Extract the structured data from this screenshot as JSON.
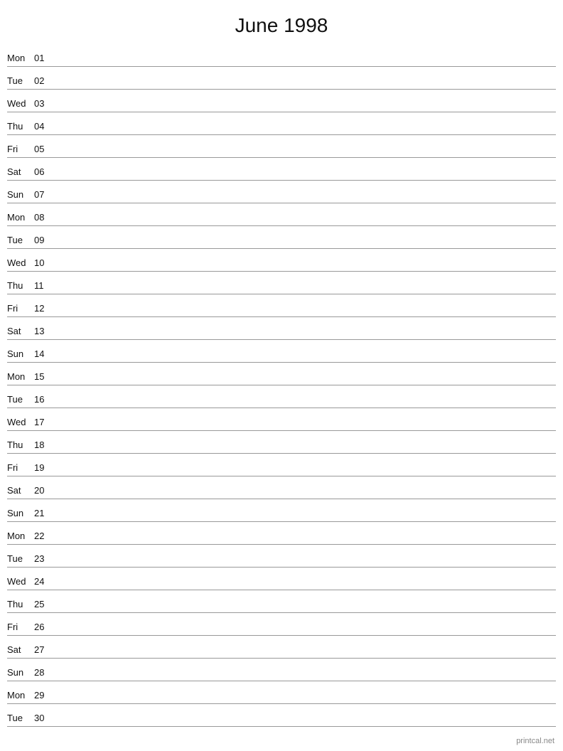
{
  "title": "June 1998",
  "days": [
    {
      "name": "Mon",
      "num": "01"
    },
    {
      "name": "Tue",
      "num": "02"
    },
    {
      "name": "Wed",
      "num": "03"
    },
    {
      "name": "Thu",
      "num": "04"
    },
    {
      "name": "Fri",
      "num": "05"
    },
    {
      "name": "Sat",
      "num": "06"
    },
    {
      "name": "Sun",
      "num": "07"
    },
    {
      "name": "Mon",
      "num": "08"
    },
    {
      "name": "Tue",
      "num": "09"
    },
    {
      "name": "Wed",
      "num": "10"
    },
    {
      "name": "Thu",
      "num": "11"
    },
    {
      "name": "Fri",
      "num": "12"
    },
    {
      "name": "Sat",
      "num": "13"
    },
    {
      "name": "Sun",
      "num": "14"
    },
    {
      "name": "Mon",
      "num": "15"
    },
    {
      "name": "Tue",
      "num": "16"
    },
    {
      "name": "Wed",
      "num": "17"
    },
    {
      "name": "Thu",
      "num": "18"
    },
    {
      "name": "Fri",
      "num": "19"
    },
    {
      "name": "Sat",
      "num": "20"
    },
    {
      "name": "Sun",
      "num": "21"
    },
    {
      "name": "Mon",
      "num": "22"
    },
    {
      "name": "Tue",
      "num": "23"
    },
    {
      "name": "Wed",
      "num": "24"
    },
    {
      "name": "Thu",
      "num": "25"
    },
    {
      "name": "Fri",
      "num": "26"
    },
    {
      "name": "Sat",
      "num": "27"
    },
    {
      "name": "Sun",
      "num": "28"
    },
    {
      "name": "Mon",
      "num": "29"
    },
    {
      "name": "Tue",
      "num": "30"
    }
  ],
  "watermark": "printcal.net"
}
